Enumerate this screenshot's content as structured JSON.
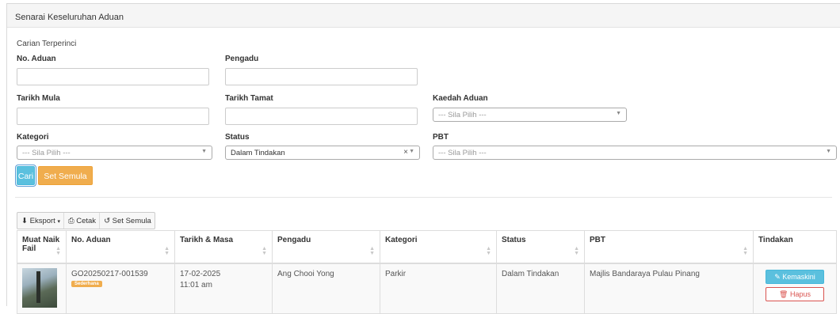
{
  "panel": {
    "title": "Senarai Keseluruhan Aduan"
  },
  "search": {
    "heading": "Carian Terperinci",
    "no_aduan_label": "No. Aduan",
    "pengadu_label": "Pengadu",
    "tarikh_mula_label": "Tarikh Mula",
    "tarikh_tamat_label": "Tarikh Tamat",
    "kaedah_label": "Kaedah Aduan",
    "kaedah_placeholder": "--- Sila Pilih ---",
    "kategori_label": "Kategori",
    "kategori_placeholder": "--- Sila Pilih ---",
    "status_label": "Status",
    "status_value": "Dalam Tindakan",
    "pbt_label": "PBT",
    "pbt_placeholder": "--- Sila Pilih ---",
    "search_button": "Cari",
    "reset_button": "Set Semula"
  },
  "toolbar": {
    "export": "Eksport",
    "print": "Cetak",
    "reset": "Set Semula"
  },
  "table": {
    "columns": [
      "Muat Naik Fail",
      "No. Aduan",
      "Tarikh & Masa",
      "Pengadu",
      "Kategori",
      "Status",
      "PBT",
      "Tindakan"
    ],
    "rows": [
      {
        "no_aduan": "GO20250217-001539",
        "badge": "Sederhana",
        "tarikh": "17-02-2025",
        "masa": "11:01 am",
        "pengadu": "Ang Chooi Yong",
        "kategori": "Parkir",
        "status": "Dalam Tindakan",
        "pbt": "Majlis Bandaraya Pulau Pinang",
        "edit_label": "Kemaskini",
        "delete_label": "Hapus"
      }
    ]
  },
  "colors": {
    "info": "#5bc0de",
    "warning": "#f0ad4e",
    "danger": "#d9534f"
  }
}
